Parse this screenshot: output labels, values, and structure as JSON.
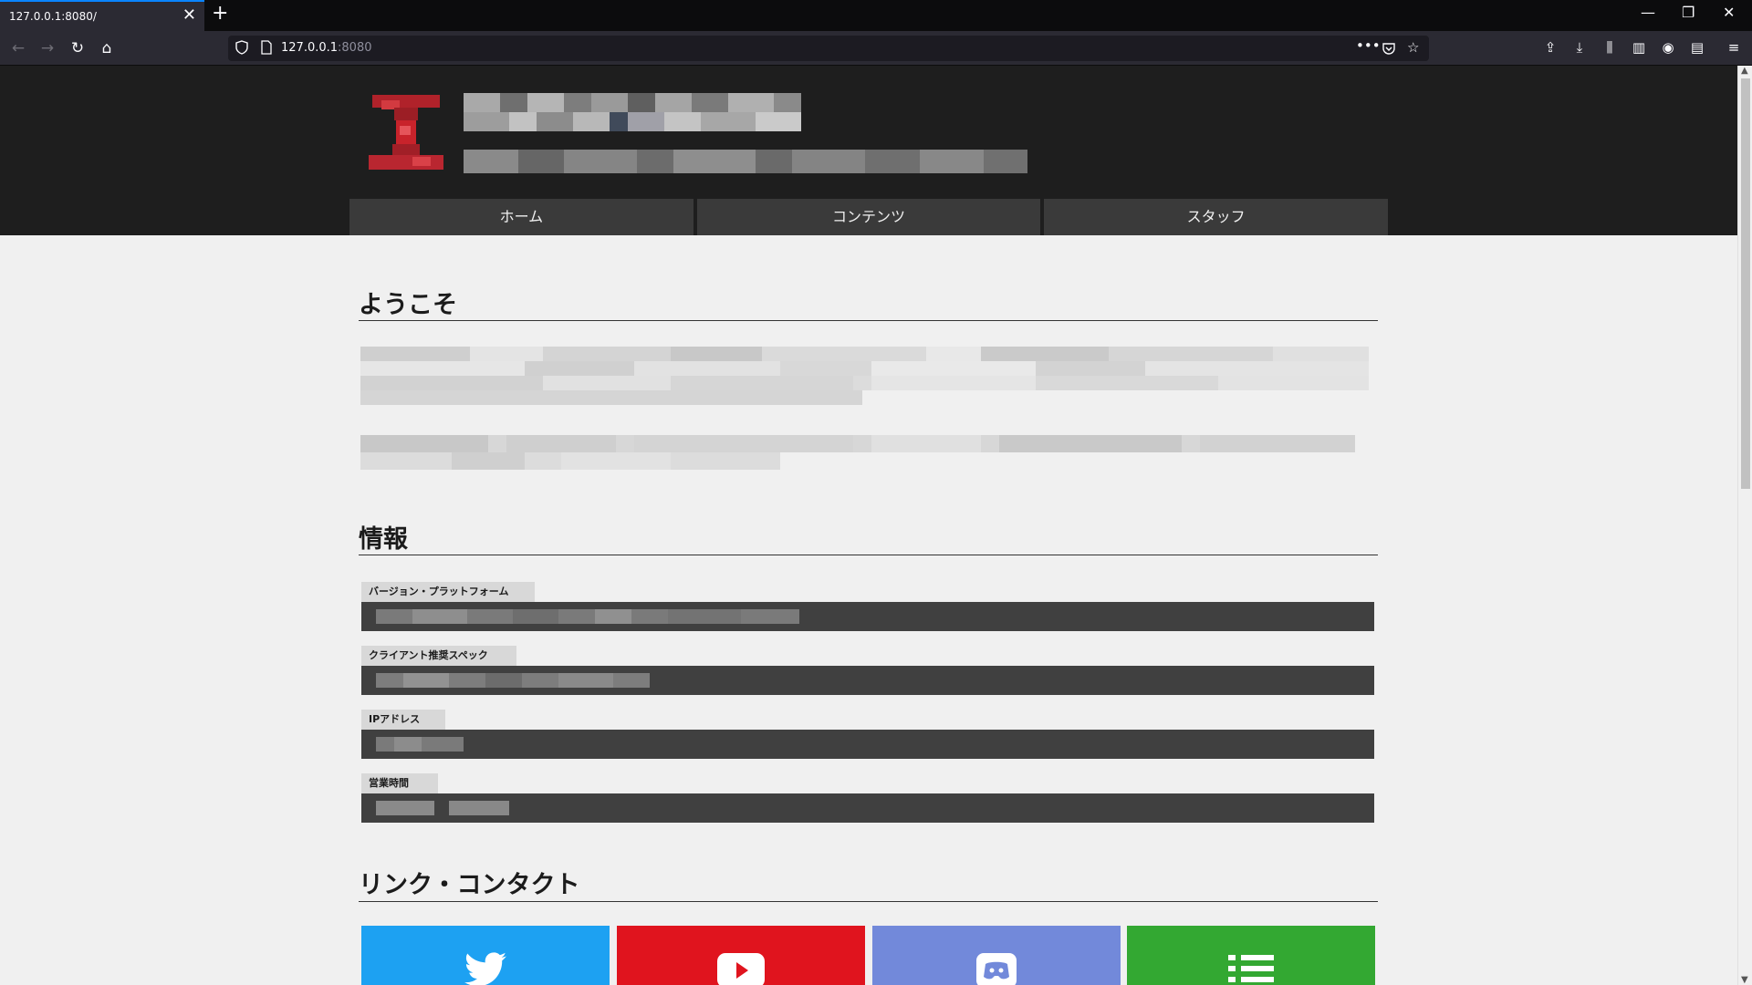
{
  "browser": {
    "tab_title": "127.0.0.1:8080/",
    "tab_close": "✕",
    "new_tab": "+",
    "url_host": "127.0.0.1",
    "url_port": ":8080",
    "window_controls": [
      "—",
      "❐",
      "✕"
    ],
    "url_actions": [
      "•••"
    ]
  },
  "nav": {
    "items": [
      {
        "label": "ホーム"
      },
      {
        "label": "コンテンツ"
      },
      {
        "label": "スタッフ"
      }
    ]
  },
  "sections": {
    "welcome": {
      "title": "ようこそ"
    },
    "info": {
      "title": "情報",
      "fields": [
        {
          "label": "バージョン・プラットフォーム"
        },
        {
          "label": "クライアント推奨スペック"
        },
        {
          "label": "IPアドレス"
        },
        {
          "label": "営業時間"
        }
      ]
    },
    "links": {
      "title": "リンク・コンタクト",
      "cards": [
        {
          "icon": "twitter-icon",
          "color": "#1da1f2"
        },
        {
          "icon": "youtube-icon",
          "color": "#e0141e"
        },
        {
          "icon": "discord-icon",
          "color": "#7289da"
        },
        {
          "icon": "list-icon",
          "color": "#33a832"
        }
      ]
    }
  },
  "colors": {
    "header_bg": "#1e1e1e",
    "page_bg": "#f0f0f0",
    "nav_item_bg": "#3a3a3a",
    "info_value_bg": "#404040",
    "logo_red": "#c8232b"
  }
}
